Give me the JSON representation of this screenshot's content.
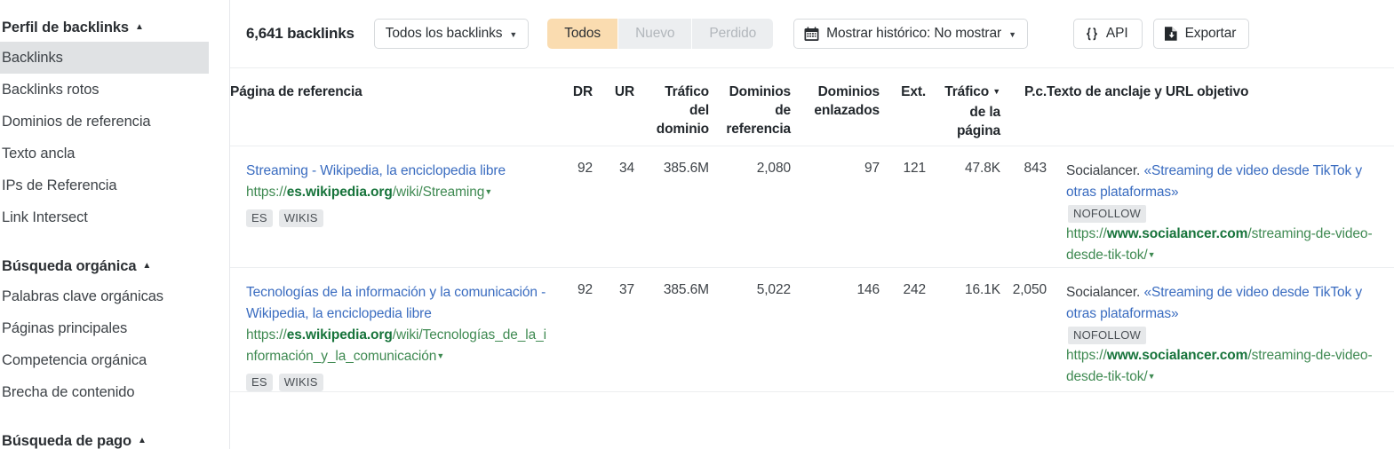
{
  "sidebar": {
    "sections": [
      {
        "title": "Perfil de backlinks",
        "caret": "▲",
        "items": [
          {
            "label": "Backlinks",
            "active": true
          },
          {
            "label": "Backlinks rotos",
            "active": false
          },
          {
            "label": "Dominios de referencia",
            "active": false
          },
          {
            "label": "Texto ancla",
            "active": false
          },
          {
            "label": "IPs de Referencia",
            "active": false
          },
          {
            "label": "Link Intersect",
            "active": false
          }
        ]
      },
      {
        "title": "Búsqueda orgánica",
        "caret": "▲",
        "items": [
          {
            "label": "Palabras clave orgánicas",
            "active": false
          },
          {
            "label": "Páginas principales",
            "active": false
          },
          {
            "label": "Competencia orgánica",
            "active": false
          },
          {
            "label": "Brecha de contenido",
            "active": false
          }
        ]
      },
      {
        "title": "Búsqueda de pago",
        "caret": "▲",
        "items": []
      }
    ]
  },
  "toolbar": {
    "count_label": "6,641 backlinks",
    "filter_dropdown": "Todos los backlinks",
    "filter_caret": "▼",
    "segments": [
      {
        "label": "Todos",
        "active": true
      },
      {
        "label": "Nuevo",
        "active": false
      },
      {
        "label": "Perdido",
        "active": false
      }
    ],
    "history_label": "Mostrar histórico: No mostrar",
    "history_caret": "▼",
    "calendar_icon": "calendar-icon",
    "api_label": "API",
    "api_icon": "braces-icon",
    "export_label": "Exportar",
    "export_icon": "download-document-icon"
  },
  "table": {
    "columns": [
      {
        "key": "page",
        "label": "Página de referencia"
      },
      {
        "key": "dr",
        "label": "DR"
      },
      {
        "key": "ur",
        "label": "UR"
      },
      {
        "key": "td",
        "label": "Tráfico del dominio"
      },
      {
        "key": "dref",
        "label": "Dominios de referencia"
      },
      {
        "key": "dlink",
        "label": "Dominios enlazados"
      },
      {
        "key": "ext",
        "label": "Ext."
      },
      {
        "key": "tp",
        "label": "Tráfico de la página",
        "sorted": true,
        "sort_caret": "▼"
      },
      {
        "key": "pc",
        "label": "P.c."
      },
      {
        "key": "anchor",
        "label": "Texto de anclaje y URL objetivo"
      }
    ],
    "column_lines": {
      "td": [
        "Tráfico",
        "del",
        "dominio"
      ],
      "dref": [
        "Dominios",
        "de",
        "referencia"
      ],
      "dlink": [
        "Dominios",
        "enlazados"
      ],
      "tp": [
        "Tráfico",
        "de la",
        "página"
      ]
    },
    "rows": [
      {
        "page_title": "Streaming - Wikipedia, la enciclopedia libre",
        "url_scheme": "https://",
        "url_domain": "es.wikipedia.org",
        "url_path": "/wiki/Streaming",
        "url_caret": "▼",
        "tags": [
          "ES",
          "WIKIS"
        ],
        "dr": "92",
        "ur": "34",
        "td": "385.6M",
        "dref": "2,080",
        "dlink": "97",
        "ext": "121",
        "tp": "47.8K",
        "pc": "843",
        "anchor_source": "Socialancer.",
        "anchor_text": "«Streaming de video desde TikTok y otras plataformas»",
        "nofollow": "NOFOLLOW",
        "target_scheme": "https://",
        "target_domain": "www.socialancer.com",
        "target_path": "/streaming-de-video-desde-tik-tok/",
        "target_caret": "▼"
      },
      {
        "page_title": "Tecnologías de la información y la comunicación - Wikipedia, la enciclopedia libre",
        "url_scheme": "https://",
        "url_domain": "es.wikipedia.org",
        "url_path": "/wiki/Tecnologías_de_la_información_y_la_comunicación",
        "url_caret": "▼",
        "tags": [
          "ES",
          "WIKIS"
        ],
        "dr": "92",
        "ur": "37",
        "td": "385.6M",
        "dref": "5,022",
        "dlink": "146",
        "ext": "242",
        "tp": "16.1K",
        "pc": "2,050",
        "anchor_source": "Socialancer.",
        "anchor_text": "«Streaming de video desde TikTok y otras plataformas»",
        "nofollow": "NOFOLLOW",
        "target_scheme": "https://",
        "target_domain": "www.socialancer.com",
        "target_path": "/streaming-de-video-desde-tik-tok/",
        "target_caret": "▼"
      }
    ]
  },
  "colors": {
    "accent_orange": "#fadcb0",
    "link_blue": "#3a6cc0",
    "url_green": "#3f8a52",
    "url_green_bold": "#16733a",
    "active_nav_bg": "#e0e2e4",
    "tag_bg": "#e6e8ea",
    "border": "#eceef0"
  }
}
